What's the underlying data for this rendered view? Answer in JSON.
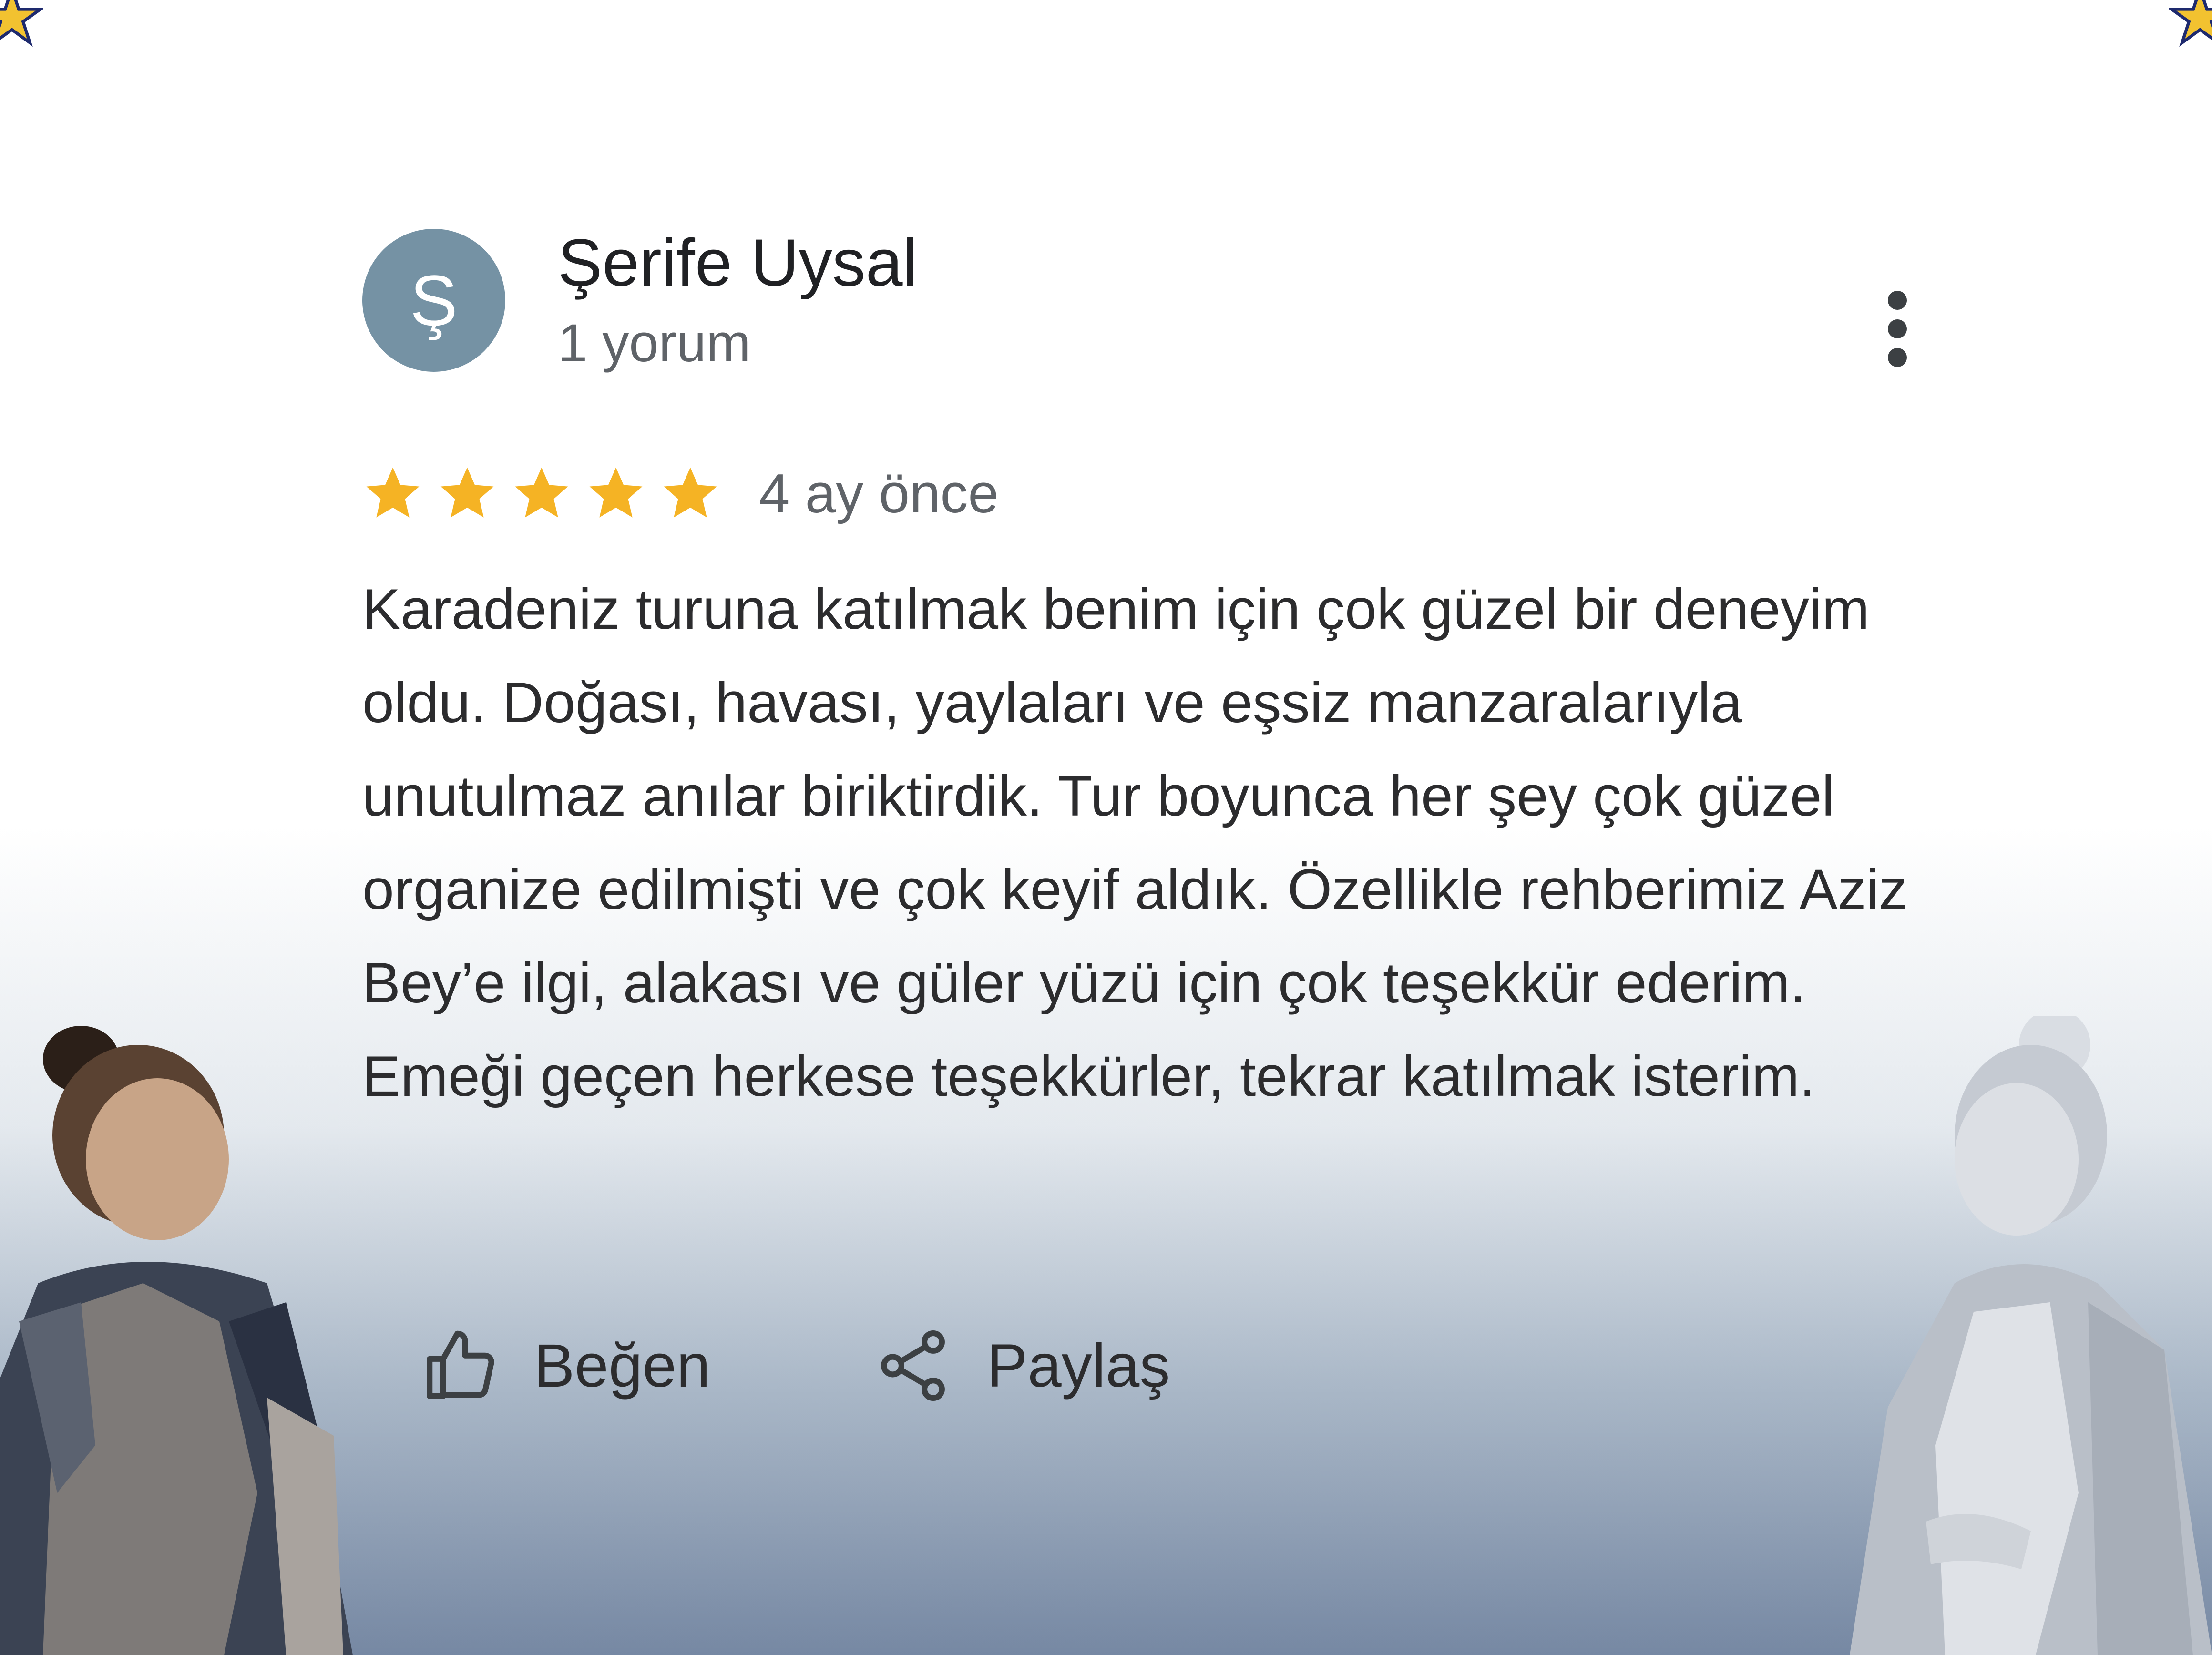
{
  "review": {
    "avatar_letter": "Ş",
    "author_name": "Şerife Uysal",
    "author_meta": "1 yorum",
    "rating_stars": 5,
    "rating_max": 5,
    "time_ago": "4 ay önce",
    "text": "Karadeniz turuna katılmak benim için çok güzel bir deneyim oldu. Doğası, havası, yaylaları ve eşsiz manzaralarıyla unutulmaz anılar biriktirdik. Tur boyunca her şey çok güzel organize edilmişti ve çok keyif aldık. Özellikle rehberimiz Aziz Bey’e ilgi, alakası ve güler yüzü için çok teşekkür ederim. Emeği geçen herkese teşekkürler, tekrar katılmak isterim.",
    "actions": {
      "like_label": "Beğen",
      "share_label": "Paylaş"
    }
  },
  "icons": {
    "more": "more-vert-icon",
    "like": "thumb-up-icon",
    "share": "share-icon",
    "star": "star-icon"
  },
  "colors": {
    "star": "#f5b324",
    "avatar_bg": "#7592a4",
    "text": "#2c2c2e",
    "muted": "#5f6368",
    "accent_star_corner": "#f2c230"
  }
}
